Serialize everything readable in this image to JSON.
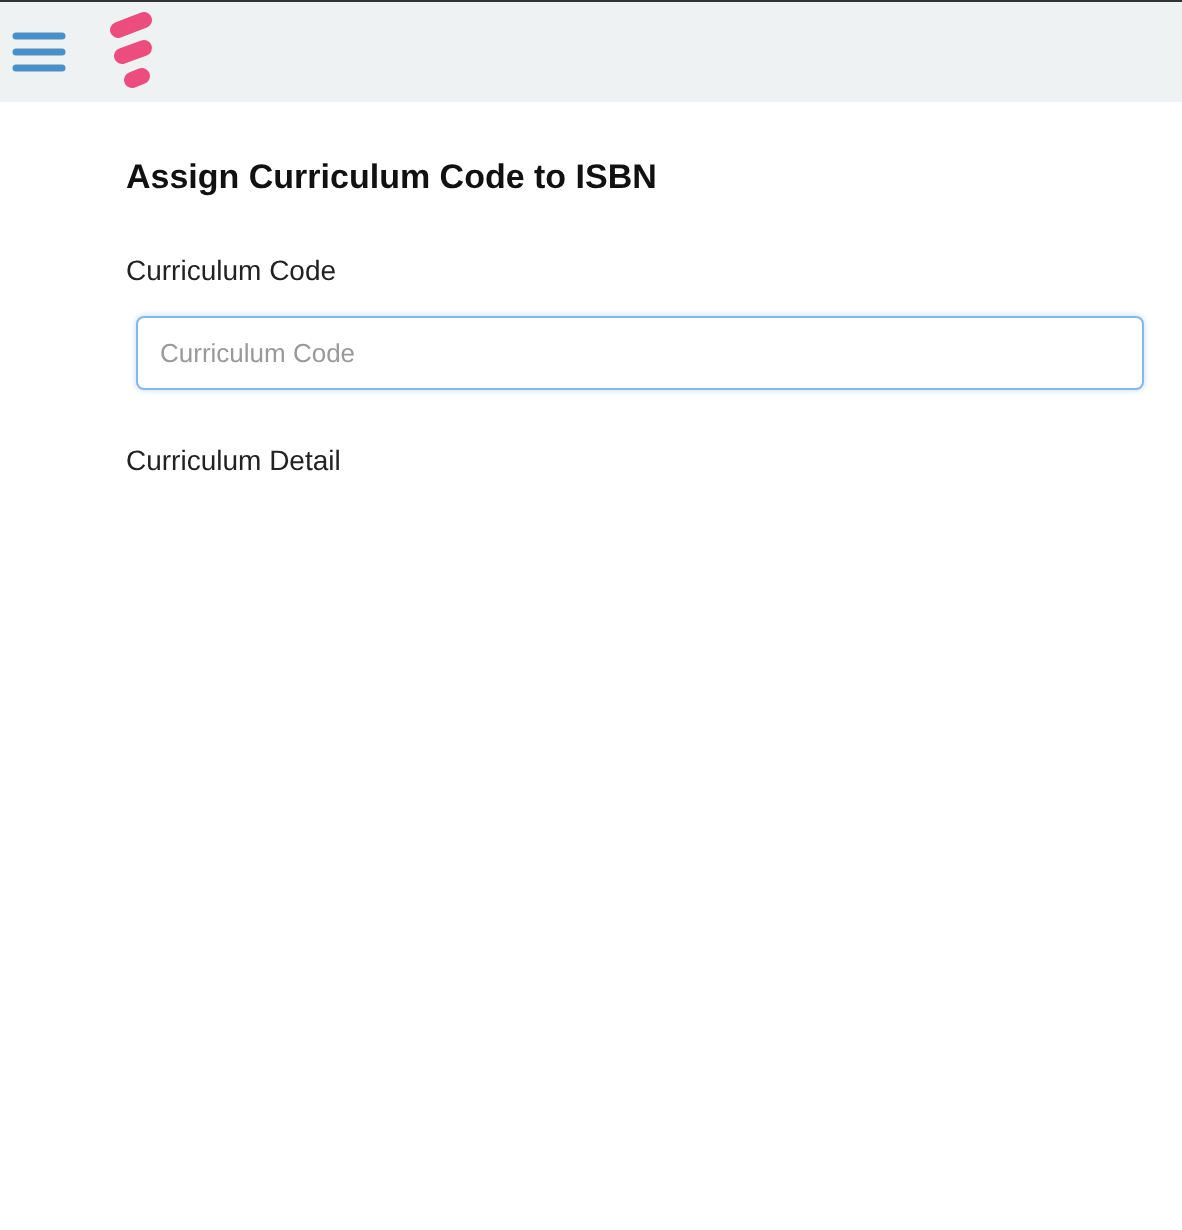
{
  "page": {
    "title": "Assign Curriculum Code to ISBN"
  },
  "form": {
    "code_label": "Curriculum Code",
    "code_field": {
      "placeholder": "Curriculum Code"
    },
    "detail_label": "Curriculum Detail"
  }
}
